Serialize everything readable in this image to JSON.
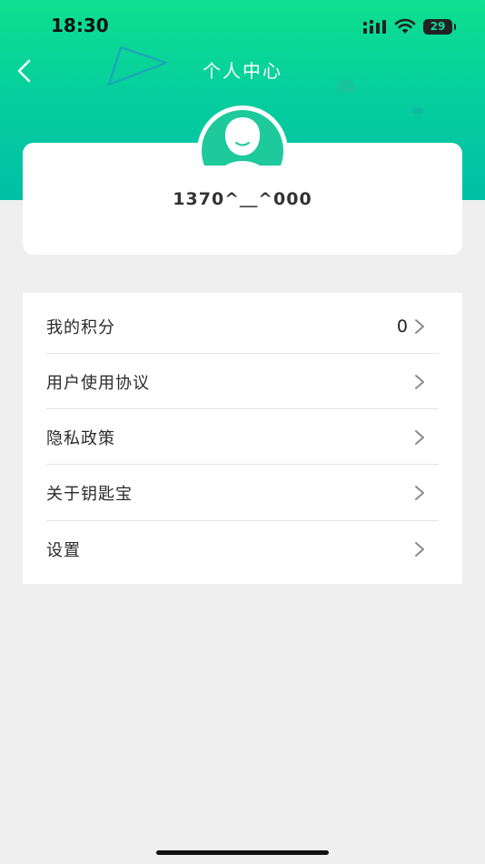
{
  "status_bar": {
    "time": "18:30",
    "battery_level": "29",
    "icons": [
      "signal-icon",
      "wifi-icon",
      "battery-icon"
    ]
  },
  "header": {
    "title": "个人中心",
    "back_icon": "chevron-left-icon"
  },
  "profile": {
    "username": "1370^＿^000",
    "avatar_icon": "user-silhouette-icon"
  },
  "menu": {
    "items": [
      {
        "label": "我的积分",
        "value": "0"
      },
      {
        "label": "用户使用协议"
      },
      {
        "label": "隐私政策"
      },
      {
        "label": "关于钥匙宝"
      },
      {
        "label": "设置"
      }
    ],
    "chevron_icon": "chevron-right-icon"
  },
  "colors": {
    "header_gradient_top": "#0ee08f",
    "header_gradient_bottom": "#00bfa6",
    "avatar": "#1ec99c",
    "background": "#efefef"
  }
}
